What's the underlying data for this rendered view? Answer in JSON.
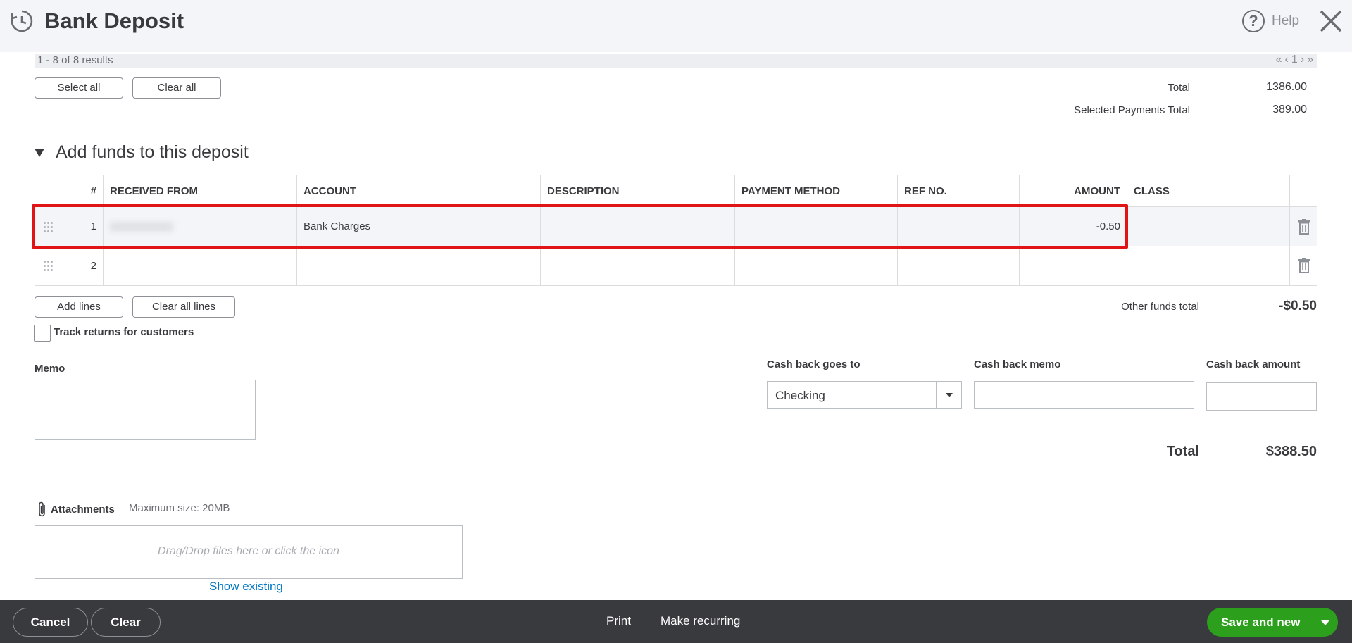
{
  "header": {
    "title": "Bank Deposit",
    "help_label": "Help",
    "icons": {
      "history": "history-clock-icon",
      "help": "question-circle-icon",
      "close": "close-icon"
    }
  },
  "results": {
    "summary": "1 - 8 of 8 results",
    "pager": {
      "first": "«",
      "prev": "‹",
      "page": "1",
      "next": "›",
      "last": "»"
    }
  },
  "payments_actions": {
    "select_all": "Select all",
    "clear_all": "Clear all"
  },
  "payments_totals": {
    "total_label": "Total",
    "total_value": "1386.00",
    "selected_label": "Selected Payments Total",
    "selected_value": "389.00"
  },
  "funds_section": {
    "title": "Add funds to this deposit"
  },
  "table": {
    "headers": [
      "#",
      "RECEIVED FROM",
      "ACCOUNT",
      "DESCRIPTION",
      "PAYMENT METHOD",
      "REF NO.",
      "AMOUNT",
      "CLASS"
    ],
    "rows": [
      {
        "num": "1",
        "received_from": "",
        "account": "Bank Charges",
        "description": "",
        "payment_method": "",
        "ref_no": "",
        "amount": "-0.50",
        "class": ""
      },
      {
        "num": "2",
        "received_from": "",
        "account": "",
        "description": "",
        "payment_method": "",
        "ref_no": "",
        "amount": "",
        "class": ""
      }
    ]
  },
  "line_actions": {
    "add_lines": "Add lines",
    "clear_all_lines": "Clear all lines"
  },
  "other_funds": {
    "label": "Other funds total",
    "value": "-$0.50"
  },
  "track_returns": {
    "label": "Track returns for customers",
    "checked": false
  },
  "memo": {
    "label": "Memo",
    "value": ""
  },
  "cash_back": {
    "goes_to_label": "Cash back goes to",
    "goes_to_value": "Checking",
    "memo_label": "Cash back memo",
    "memo_value": "",
    "amount_label": "Cash back amount",
    "amount_value": ""
  },
  "grand_total": {
    "label": "Total",
    "value": "$388.50"
  },
  "attachments": {
    "title": "Attachments",
    "max_size": "Maximum size: 20MB",
    "dropzone_text": "Drag/Drop files here or click the icon",
    "show_existing": "Show existing"
  },
  "footer": {
    "cancel": "Cancel",
    "clear": "Clear",
    "print": "Print",
    "make_recurring": "Make recurring",
    "save_and_new": "Save and new"
  },
  "colors": {
    "accent_green": "#2ca01c",
    "highlight_red": "#e01414",
    "link_blue": "#0077c5",
    "footer_bg": "#393a3d"
  }
}
